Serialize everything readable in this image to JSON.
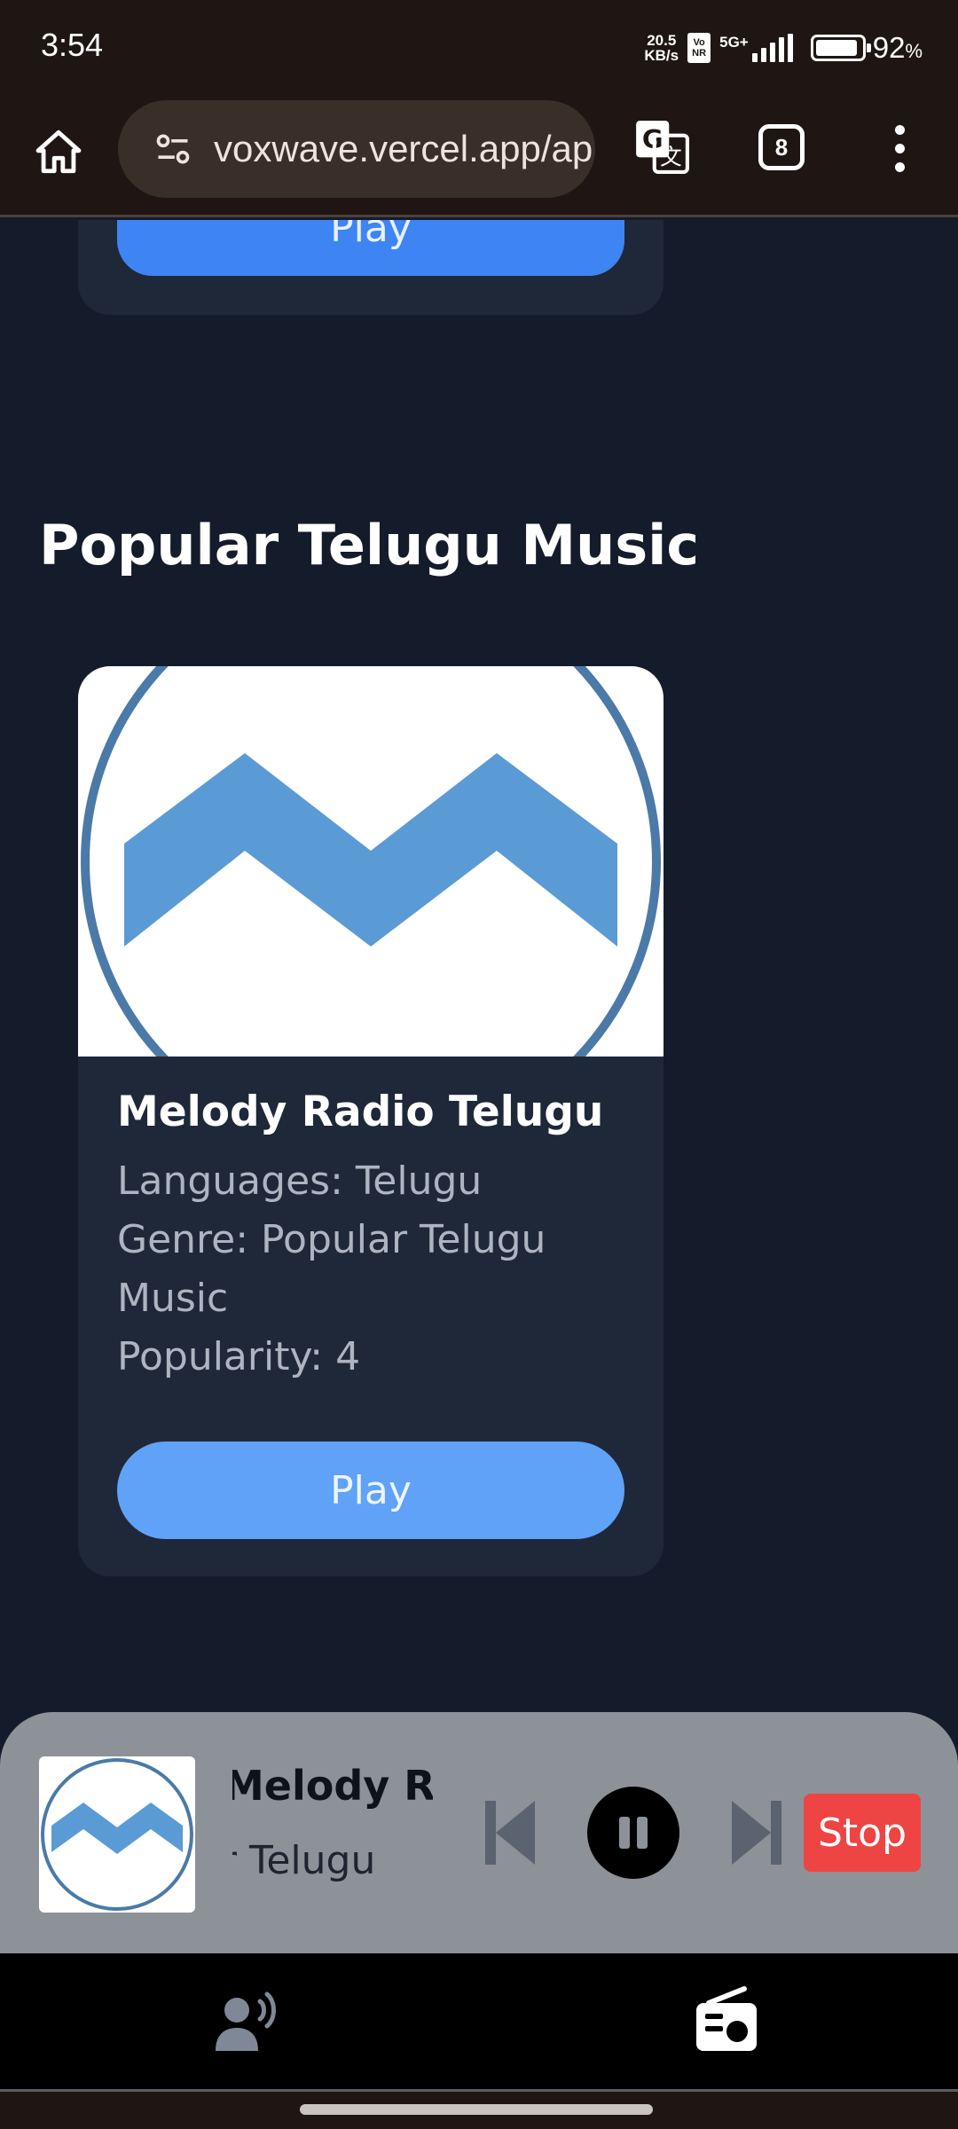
{
  "status_bar": {
    "time": "3:54",
    "net_speed_value": "20.5",
    "net_speed_unit": "KB/s",
    "volte_top": "Vo",
    "volte_bottom": "NR",
    "network": "5G+",
    "battery_percent": "92",
    "battery_symbol": "%",
    "battery_level": 0.92
  },
  "browser": {
    "url": "voxwave.vercel.app/ap",
    "tab_count": "8"
  },
  "previous_card": {
    "play_label": "Play"
  },
  "section": {
    "title": "Popular Telugu Music"
  },
  "station": {
    "name": "Melody Radio Telugu",
    "languages": "Languages: Telugu",
    "genre_line1": "Genre: Popular Telugu",
    "genre_line2": "Music",
    "popularity": "Popularity: 4",
    "play_label": "Play"
  },
  "player": {
    "title": "Melody Ra",
    "genre": "Popular Telugu",
    "stop_label": "Stop"
  },
  "icons": {
    "home": "home-icon",
    "site_settings": "site-settings-icon",
    "translate": "translate-icon",
    "menu": "more-vert-icon",
    "prev": "skip-previous-icon",
    "pause": "pause-icon",
    "next": "skip-next-icon",
    "speaker": "voice-speaker-icon",
    "radio": "radio-icon"
  },
  "colors": {
    "page_bg": "#141b2b",
    "card_bg": "#1f2839",
    "play_button": "#5fa2f8",
    "stop_button": "#ef4444",
    "logo_blue": "#5b9bd5"
  }
}
